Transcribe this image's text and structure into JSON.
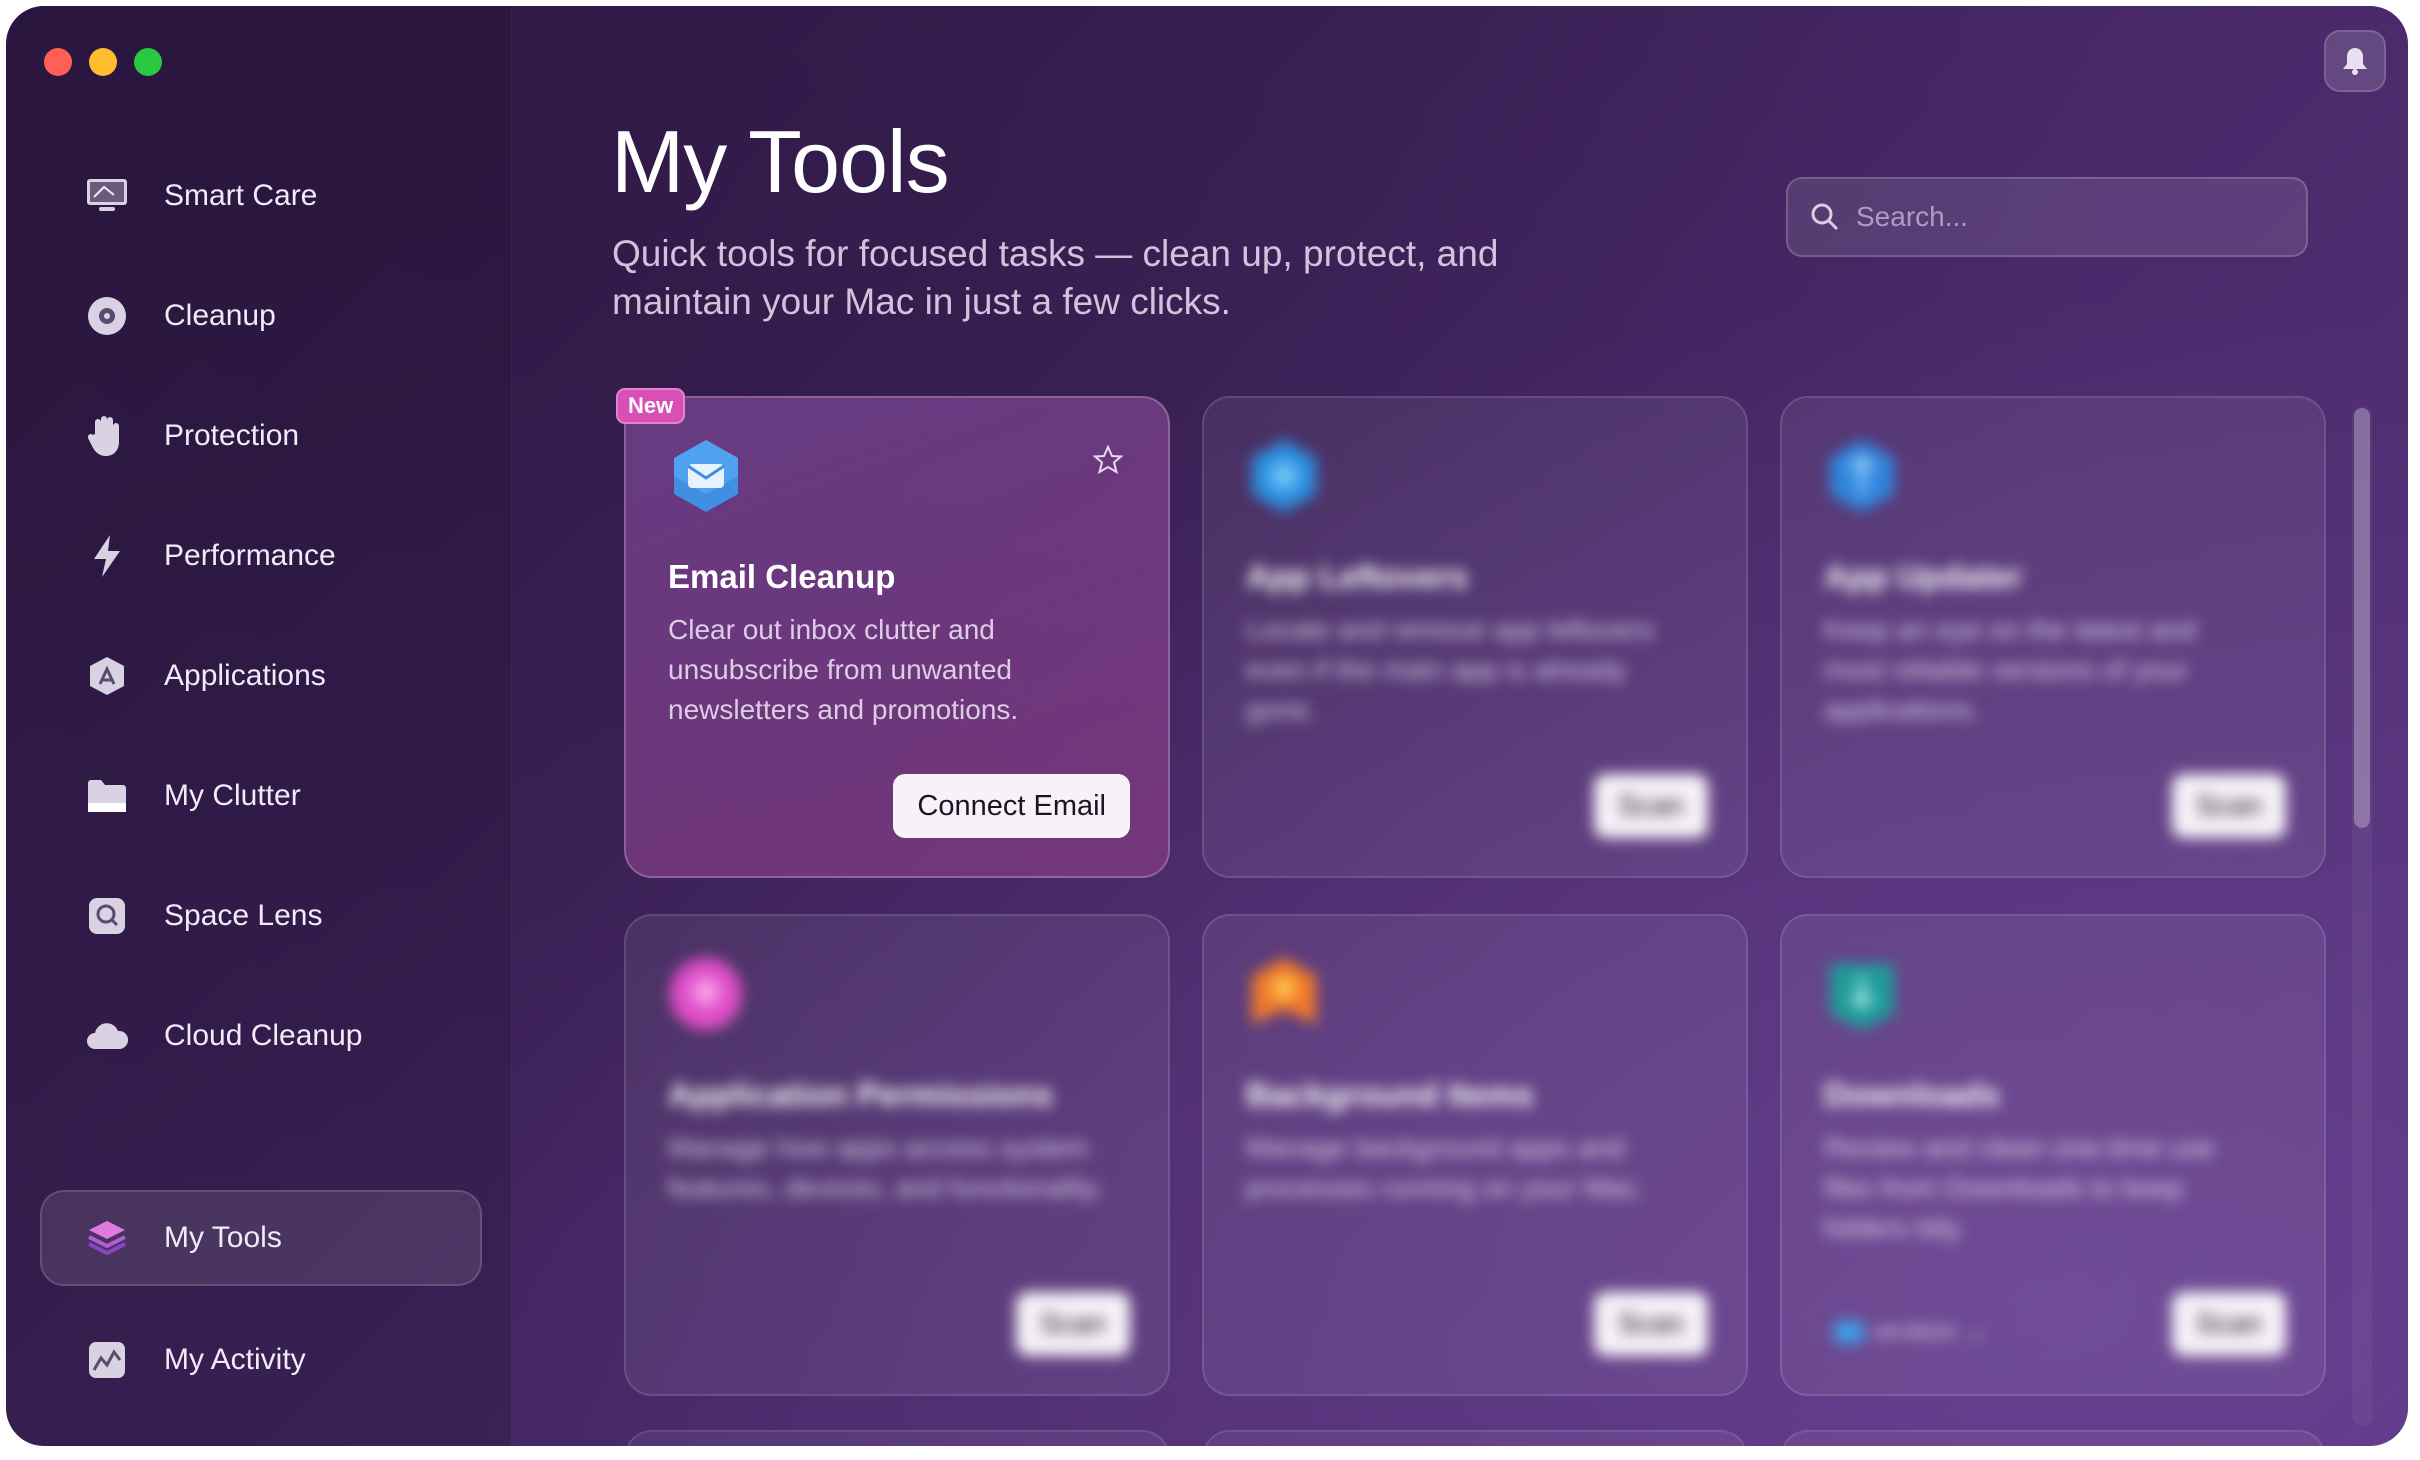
{
  "colors": {
    "accent": "#d94fb8",
    "window_bg": "#3a2054"
  },
  "sidebar": {
    "items": [
      {
        "label": "Smart Care",
        "icon": "monitor-icon"
      },
      {
        "label": "Cleanup",
        "icon": "disc-icon"
      },
      {
        "label": "Protection",
        "icon": "hand-icon"
      },
      {
        "label": "Performance",
        "icon": "bolt-icon"
      },
      {
        "label": "Applications",
        "icon": "appstore-icon"
      },
      {
        "label": "My Clutter",
        "icon": "folder-icon"
      },
      {
        "label": "Space Lens",
        "icon": "lens-icon"
      },
      {
        "label": "Cloud Cleanup",
        "icon": "cloud-icon"
      }
    ],
    "bottom_items": [
      {
        "label": "My Tools",
        "icon": "layers-icon",
        "active": true
      },
      {
        "label": "My Activity",
        "icon": "chart-icon"
      }
    ]
  },
  "header": {
    "title": "My Tools",
    "subtitle": "Quick tools for focused tasks — clean up, protect, and maintain your Mac in just a few clicks.",
    "search_placeholder": "Search..."
  },
  "cards": [
    {
      "title": "Email Cleanup",
      "desc": "Clear out inbox clutter and unsubscribe from unwanted newsletters and promotions.",
      "button": "Connect Email",
      "badge": "New",
      "icon": "email-icon"
    },
    {
      "title": "App Leftovers",
      "desc": "Locate and remove app leftovers even if the main app is already gone.",
      "button": "Scan",
      "icon": "leftovers-icon"
    },
    {
      "title": "App Updater",
      "desc": "Keep an eye on the latest and most reliable versions of your applications.",
      "button": "Scan",
      "icon": "updater-icon"
    },
    {
      "title": "Application Permissions",
      "desc": "Manage how apps access system features, devices, and functionality.",
      "button": "Scan",
      "icon": "permissions-icon"
    },
    {
      "title": "Background Items",
      "desc": "Manage background apps and processes running on your Mac.",
      "button": "Scan",
      "icon": "background-icon"
    },
    {
      "title": "Downloads",
      "desc": "Review and clean one-time use files from Downloads to keep folders tidy.",
      "button": "Scan",
      "icon": "downloads-icon",
      "folder": "anvikon"
    }
  ]
}
